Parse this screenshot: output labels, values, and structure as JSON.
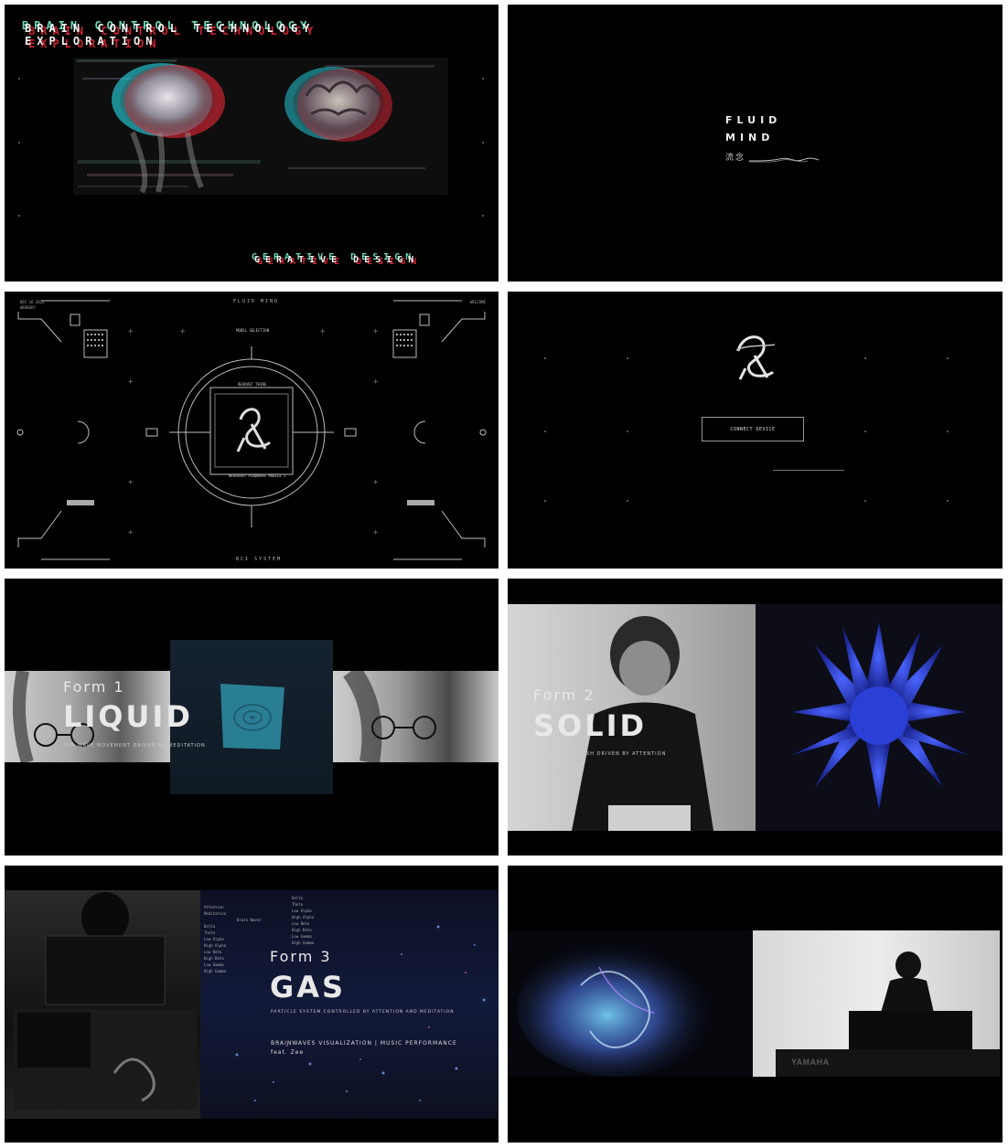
{
  "panels": {
    "p1": {
      "title_line1": "BRAIN CONTROL TECHNOLOGY",
      "title_line2": "EXPLORATION",
      "footer": "GERATIVE DESIGN"
    },
    "p2": {
      "line1": "FLUID",
      "line2": "MIND",
      "cjk": "流念"
    },
    "p3": {
      "top_center": "FLUID MIND",
      "top_left_1": "DEC 16 2022",
      "top_left_2": "WEEKDAY",
      "top_right": "WELCOME",
      "model_selection": "MODEL SELECTION",
      "ring_top": "READUST THING",
      "ring_bottom": "NEUROSKY MINDWAVE MOBILE 2",
      "bottom_center": "BCI SYSTEM"
    },
    "p4": {
      "button": "CONNECT DEVICE"
    },
    "p5": {
      "form": "Form 1",
      "title": "LIQUID",
      "subtitle": "SIN WAVE MOVEMENT DRIVEN BY MEDITATION"
    },
    "p6": {
      "form": "Form 2",
      "title": "SOLID",
      "subtitle": "PROCEDURAL MESH DRIVEN BY ATTENTION"
    },
    "p7": {
      "form": "Form 3",
      "title": "GAS",
      "subtitle": "PARTICLE SYSTEM CONTROLLED BY ATTENTION AND MEDITATION",
      "line2": "BRAINWAVES VISUALIZATION | MUSIC PERFORMANCE",
      "line3": "feat. Zee",
      "table_left": [
        "Attention",
        "Meditation",
        "Brain Waves",
        "Delta",
        "Theta",
        "Low Alpha",
        "High Alpha",
        "Low Beta",
        "High Beta",
        "Low Gamma",
        "High Gamma"
      ],
      "table_right": [
        "Delta",
        "Theta",
        "Low Alpha",
        "High Alpha",
        "Low Beta",
        "High Beta",
        "Low Gamma",
        "High Gamma"
      ]
    },
    "p8": {
      "brand": "YAMAHA"
    }
  },
  "colors": {
    "panel_bg": "#000000",
    "page_bg": "#ffffff",
    "glitch_red": "#ff2a3c",
    "glitch_cyan": "#2af0ff",
    "solid_blue": "#2a3fd6",
    "liquid_teal": "#2f8fa6"
  }
}
